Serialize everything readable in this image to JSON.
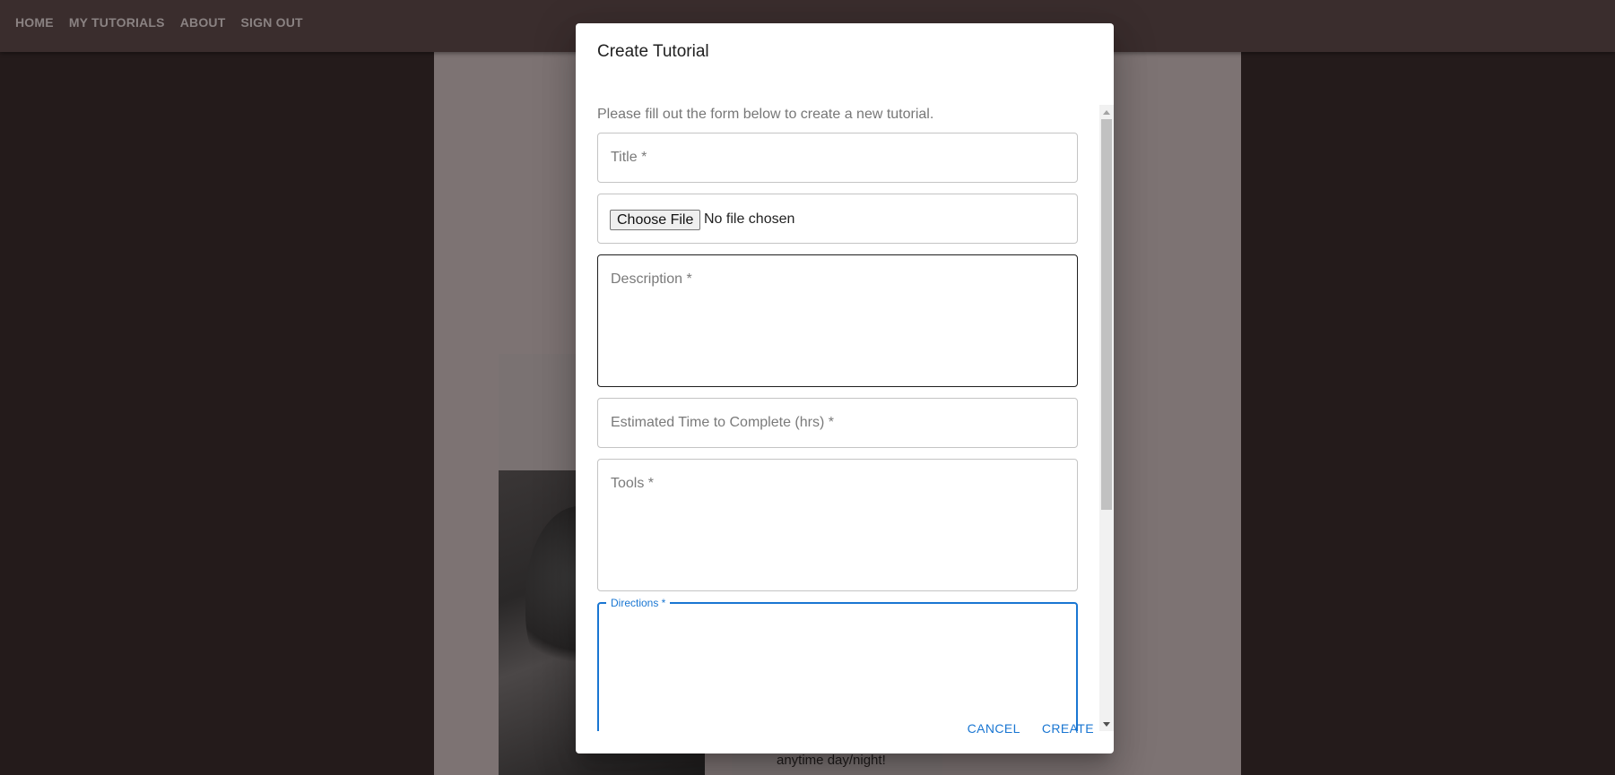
{
  "nav": {
    "items": [
      {
        "label": "HOME"
      },
      {
        "label": "MY TUTORIALS"
      },
      {
        "label": "ABOUT"
      },
      {
        "label": "SIGN OUT"
      }
    ]
  },
  "background": {
    "card_text": "anytime day/night!"
  },
  "dialog": {
    "title": "Create Tutorial",
    "instructions": "Please fill out the form below to create a new tutorial.",
    "fields": {
      "title_label": "Title *",
      "file_button": "Choose File",
      "file_status": "No file chosen",
      "description_label": "Description *",
      "time_label": "Estimated Time to Complete (hrs) *",
      "tools_label": "Tools *",
      "directions_label": "Directions *"
    },
    "actions": {
      "cancel": "CANCEL",
      "create": "CREATE"
    }
  },
  "colors": {
    "primary": "#1976d2",
    "nav_bg": "#3a2d2d",
    "page_bg": "#241b1b"
  }
}
